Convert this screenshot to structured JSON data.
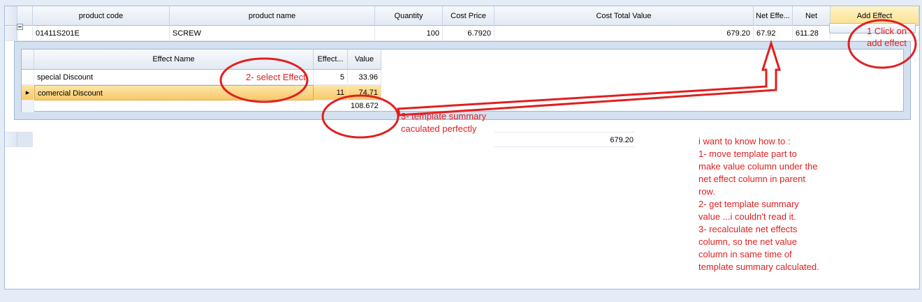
{
  "main_grid": {
    "columns": [
      "product code",
      "product name",
      "Quantity",
      "Cost Price",
      "Cost Total Value",
      "Net Effe...",
      "Net",
      "Add Effect"
    ],
    "row": {
      "product_code": "01411S201E",
      "product_name": "SCREW",
      "quantity": "100",
      "cost_price": "6.7920",
      "cost_total_value": "679.20",
      "net_effect": "67.92",
      "net": "611.28"
    },
    "footer_total": "679.20"
  },
  "detail_grid": {
    "columns": [
      "Effect Name",
      "Effect...",
      "Value"
    ],
    "rows": [
      {
        "name": "special Discount",
        "effect": "5",
        "value": "33.96"
      },
      {
        "name": "comercial Discount",
        "effect": "11",
        "value": "74.71"
      }
    ],
    "summary_value": "108.672"
  },
  "annotations": {
    "step1_line1": "1 Click on",
    "step1_line2": "add effect",
    "step2": "2- select Effect",
    "step3_line1": "3- template summary",
    "step3_line2": "caculated perfectly",
    "note_lines": [
      "i want to know how to :",
      "1- move template part to",
      "make value column under the",
      "net effect column in parent",
      "row.",
      "2- get template summary",
      "value ...i couldn't read it.",
      "3- recalculate net effects",
      "column, so tne net value",
      "column in same time of",
      "template summary calculated."
    ]
  },
  "colors": {
    "annotation_red": "#e02020",
    "selection_orange": "#f8c86a",
    "header_blue": "#e3e9f3"
  }
}
